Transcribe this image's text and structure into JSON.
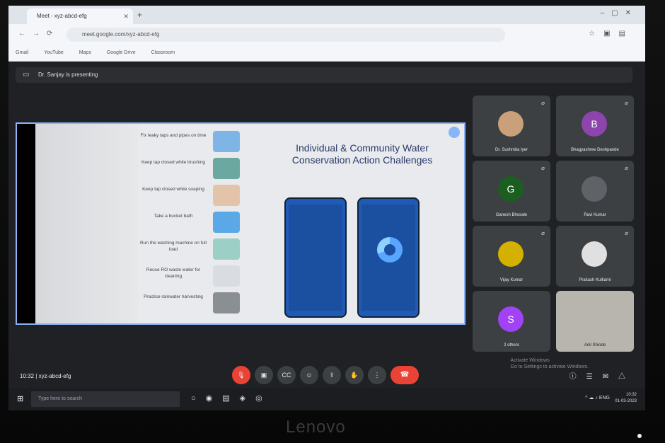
{
  "browser": {
    "tab_title": "Meet - xyz-abcd-efg",
    "url": "meet.google.com/xyz-abcd-efg",
    "bookmarks": [
      "Gmail",
      "YouTube",
      "Maps",
      "Google Drive",
      "Classroom"
    ]
  },
  "meet": {
    "presenting_banner": "Dr. Sanjay is presenting",
    "slide": {
      "title": "Individual & Community Water Conservation Action Challenges",
      "actions": [
        "Fix leaky taps and pipes on time",
        "Keep tap closed while brushing",
        "Keep tap closed while soaping",
        "Take a bucket bath",
        "Run the washing machine on full load",
        "Reuse RO waste water for cleaning",
        "Practice rainwater harvesting"
      ]
    },
    "participants": [
      {
        "name": "Dr. Sushmita Iyer",
        "initial": "",
        "color": "#c9a07a"
      },
      {
        "name": "Bhagyashree Deshpande",
        "initial": "B",
        "color": "#8e44ad"
      },
      {
        "name": "Ganesh Bhosale",
        "initial": "G",
        "color": "#1b5e20"
      },
      {
        "name": "Ravi Kumar",
        "initial": "",
        "color": "#5f6368"
      },
      {
        "name": "Vijay Kumar",
        "initial": "",
        "color": "#d4b000"
      },
      {
        "name": "Prakash Kulkarni",
        "initial": "",
        "color": "#e0e0e0"
      },
      {
        "name": "2 others",
        "initial": "S",
        "color": "#a142f4"
      },
      {
        "name": "Anil Shinde",
        "initial": "",
        "color": ""
      }
    ],
    "time": "10:32",
    "meeting_code": "xyz-abcd-efg",
    "watermark_line1": "Activate Windows",
    "watermark_line2": "Go to Settings to activate Windows."
  },
  "taskbar": {
    "search_placeholder": "Type here to search",
    "clock_time": "10:32",
    "clock_date": "01-03-2023"
  },
  "monitor_brand": "Lenovo"
}
